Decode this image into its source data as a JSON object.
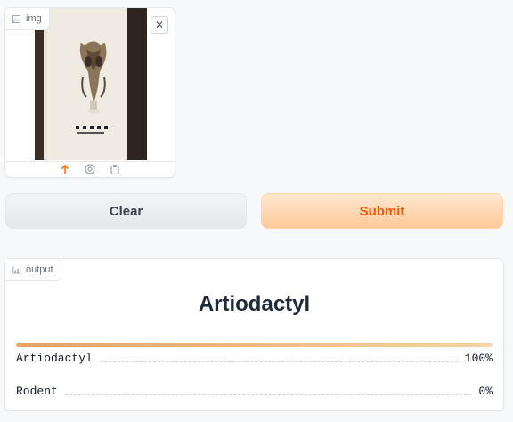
{
  "input_panel": {
    "label": "img",
    "label_icon": "image-icon",
    "close_symbol": "✕",
    "toolbar_icons": [
      "upload-icon",
      "webcam-icon",
      "clipboard-icon"
    ],
    "accent_color": "#f97316"
  },
  "buttons": {
    "clear_label": "Clear",
    "submit_label": "Submit"
  },
  "output_panel": {
    "label": "output",
    "label_icon": "chart-icon",
    "top_label": "Artiodactyl",
    "confidences": [
      {
        "label": "Artiodactyl",
        "value": "100%",
        "fraction": 1.0
      },
      {
        "label": "Rodent",
        "value": "0%",
        "fraction": 0.0
      }
    ]
  }
}
